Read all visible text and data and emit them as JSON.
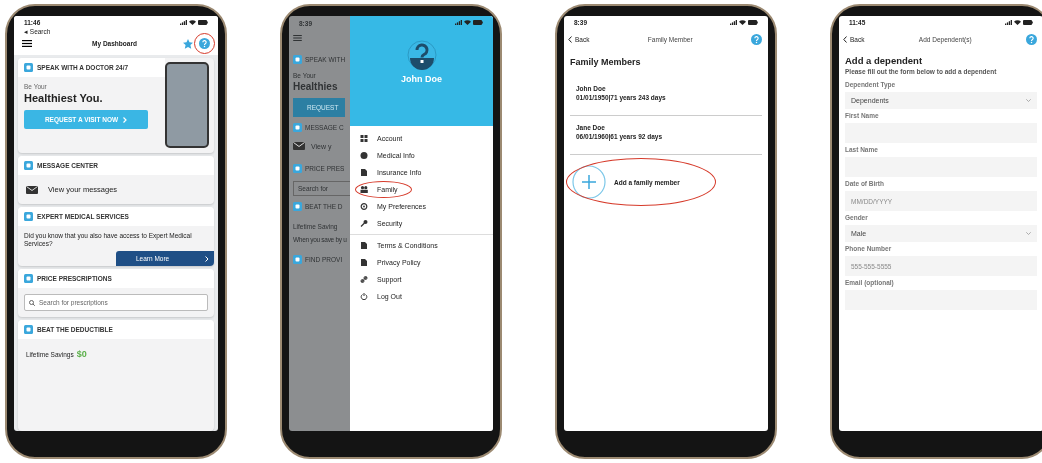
{
  "dashboard": {
    "status_time": "11:46",
    "back_label": "◂ Search",
    "title": "My Dashboard",
    "help_highlighted": true,
    "doctor_card": {
      "title": "SPEAK WITH A DOCTOR 24/7",
      "kicker": "Be Your",
      "headline": "Healthiest You.",
      "button": "REQUEST A VISIT NOW"
    },
    "message_card": {
      "title": "MESSAGE CENTER",
      "link": "View your messages"
    },
    "expert_card": {
      "title": "EXPERT MEDICAL SERVICES",
      "text": "Did you know that you also have access to Expert Medical Services?",
      "button": "Learn More"
    },
    "prescription_card": {
      "title": "PRICE PRESCRIPTIONS",
      "placeholder": "Search for prescriptions"
    },
    "deductible_card": {
      "title": "BEAT THE DEDUCTIBLE",
      "label": "Lifetime Savings",
      "amount": "$0"
    }
  },
  "menu_screen": {
    "status_time": "8:39",
    "background": [
      {
        "kind": "section",
        "text": "SPEAK WITH"
      },
      {
        "kind": "kicker",
        "text": "Be Your"
      },
      {
        "kind": "headline",
        "text": "Healthies"
      },
      {
        "kind": "button",
        "text": "REQUEST"
      },
      {
        "kind": "section",
        "text": "MESSAGE C"
      },
      {
        "kind": "message",
        "text": "View y"
      },
      {
        "kind": "section",
        "text": "PRICE PRES"
      },
      {
        "kind": "field",
        "text": "Search for"
      },
      {
        "kind": "section",
        "text": "BEAT THE D"
      },
      {
        "kind": "text",
        "text": "Lifetime Saving"
      },
      {
        "kind": "small",
        "text": "When you save by u"
      },
      {
        "kind": "section",
        "text": "FIND PROVI"
      }
    ],
    "user_name": "John Doe",
    "items": [
      {
        "label": "Account",
        "highlighted": false
      },
      {
        "label": "Medical Info",
        "highlighted": false
      },
      {
        "label": "Insurance Info",
        "highlighted": false
      },
      {
        "label": "Family",
        "highlighted": true
      },
      {
        "label": "My Preferences",
        "highlighted": false
      },
      {
        "label": "Security",
        "highlighted": false
      }
    ],
    "footer_items": [
      {
        "label": "Terms & Conditions"
      },
      {
        "label": "Privacy Policy"
      },
      {
        "label": "Support"
      },
      {
        "label": "Log Out"
      }
    ]
  },
  "family_screen": {
    "status_time": "8:39",
    "back_label": "Back",
    "title": "Family Member",
    "heading": "Family Members",
    "members": [
      {
        "name": "John Doe",
        "detail": "01/01/1950|71 years 243 days"
      },
      {
        "name": "Jane Doe",
        "detail": "06/01/1960|61 years 92 days"
      }
    ],
    "add_label": "Add a family member",
    "add_highlighted": true
  },
  "dependent_screen": {
    "status_time": "11:45",
    "back_label": "Back",
    "title": "Add Dependent(s)",
    "heading": "Add a dependent",
    "subtitle": "Please fill out the form below to add a dependent",
    "fields": [
      {
        "kind": "select",
        "label": "Dependent Type",
        "value": "Dependents"
      },
      {
        "kind": "text",
        "label": "First Name"
      },
      {
        "kind": "text",
        "label": "Last Name"
      },
      {
        "kind": "text",
        "label": "Date of Birth",
        "placeholder": "MM/DD/YYYY"
      },
      {
        "kind": "select",
        "label": "Gender",
        "value": "Male"
      },
      {
        "kind": "text",
        "label": "Phone Number",
        "placeholder": "555-555-5555"
      },
      {
        "kind": "text",
        "label": "Email (optional)"
      }
    ]
  }
}
